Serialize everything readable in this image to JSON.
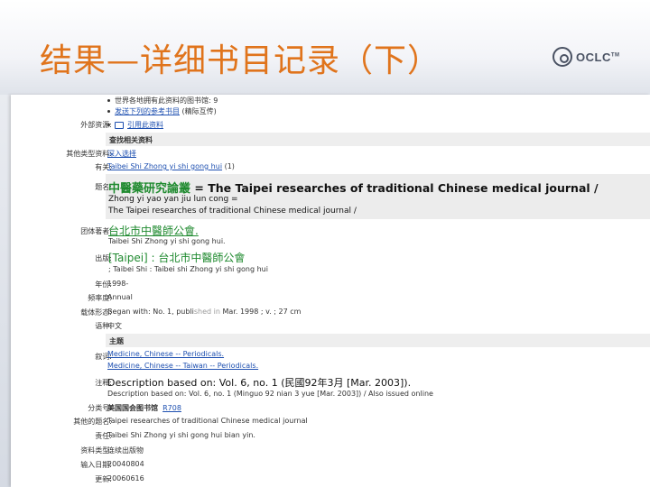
{
  "slide": {
    "title": "结果—详细书目记录（下）",
    "logo_text": "OCLC",
    "logo_tm": "TM"
  },
  "record": {
    "top_items": [
      "世界各地拥有此资料的图书馆: 9",
      "发送下列的参考书目 (精际互传)"
    ],
    "top_item_1_link": "发送下列的参考书目",
    "top_item_1_suffix": " (精际互传)",
    "external_resources": {
      "label": "外部资源:",
      "link": "引用此资料"
    },
    "find_related_header": "查找相关资料",
    "other_versions": {
      "label": "其他类型资料:",
      "link": "深入选择"
    },
    "related": {
      "label": "有关:",
      "link": "Taibei Shi Zhong yi shi gong hui",
      "suffix": " (1)"
    },
    "title_field": {
      "label": "题名:",
      "line1_cjk": "中醫藥研究論叢",
      "line1_rest": " = The Taipei researches of traditional Chinese medical journal /",
      "line2": "Zhong yi yao yan jiu lun cong =",
      "line3": "The Taipei researches of traditional Chinese medical journal /"
    },
    "corporate_author": {
      "label": "团体著者:",
      "cjk": "台北市中醫師公會.",
      "roman": "Taibei Shi Zhong yi shi gong hui."
    },
    "publication": {
      "label": "出版:",
      "cjk": "[Taipei] : 台北市中醫師公會",
      "roman": "; Taibei Shi : Taibei shi Zhong yi shi gong hui"
    },
    "year": {
      "label": "年份:",
      "value": "1998-"
    },
    "frequency": {
      "label": "频率度:",
      "value": "Annual"
    },
    "description": {
      "label": "载体形态:",
      "value_a": "Began with: No. 1, publi",
      "value_faded": "shed in",
      "value_b": " Mar. 1998 ; v. ; 27 cm"
    },
    "language": {
      "label": "语种:",
      "value": "中文"
    },
    "subjects_header": "主题",
    "subjects": {
      "label": "叙词:",
      "items": [
        "Medicine, Chinese -- Periodicals.",
        "Medicine, Chinese -- Taiwan -- Periodicals."
      ]
    },
    "notes": {
      "label": "注释:",
      "line1": "Description based on: Vol. 6, no. 1 (民國92年3月 [Mar. 2003]).",
      "line2": "Description based on: Vol. 6, no. 1 (Minguo 92 nian 3 yue [Mar. 2003]) / Also issued online"
    },
    "class_number": {
      "label": "分类号:",
      "value_bold": "美国国会图书馆",
      "value_rest": "R708"
    },
    "other_titles": {
      "label": "其他的题名:",
      "value": "Taipei researches of traditional Chinese medical journal"
    },
    "responsibility": {
      "label": "责任:",
      "value": "Taibei Shi Zhong yi shi gong hui bian yin."
    },
    "document_type": {
      "label": "资料类型:",
      "value": "连续出版物"
    },
    "entry_date": {
      "label": "输入日期:",
      "value": "20040804"
    },
    "update_date": {
      "label": "更新:",
      "value": "20060616"
    }
  },
  "colors": {
    "title": "#e0741c",
    "link": "#1d4fb0",
    "cjk_green": "#1f8a2f",
    "section_bar": "#eeeeee"
  }
}
